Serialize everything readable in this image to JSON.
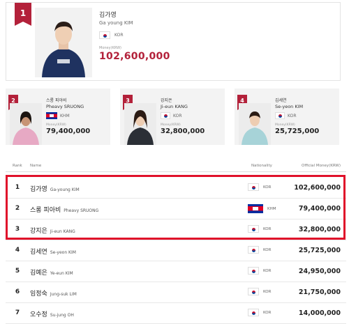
{
  "top": {
    "rank": "1",
    "name_ko": "김가영",
    "name_en": "Ga young KIM",
    "nationality": "KOR",
    "money_label": "Money(KRW)",
    "money": "102,600,000"
  },
  "cards": [
    {
      "rank": "2",
      "name_ko": "스롱 피아비",
      "name_en": "Pheavy SRUONG",
      "nationality": "KHM",
      "money_label": "Money(KRW)",
      "money": "79,400,000",
      "flag": "khm"
    },
    {
      "rank": "3",
      "name_ko": "강지은",
      "name_en": "Ji-eun KANG",
      "nationality": "KOR",
      "money_label": "Money(KRW)",
      "money": "32,800,000",
      "flag": "kor"
    },
    {
      "rank": "4",
      "name_ko": "김세연",
      "name_en": "Se-yeon KIM",
      "nationality": "KOR",
      "money_label": "Money(KRW)",
      "money": "25,725,000",
      "flag": "kor"
    }
  ],
  "table": {
    "headers": {
      "rank": "Rank",
      "name": "Name",
      "nationality": "Nationality",
      "money": "Official Money(KRW)"
    },
    "rows": [
      {
        "rank": "1",
        "name_ko": "김가영",
        "name_en": "Ga-young KIM",
        "nationality": "KOR",
        "money": "102,600,000",
        "flag": "kor"
      },
      {
        "rank": "2",
        "name_ko": "스롱 피아비",
        "name_en": "Pheavy SRUONG",
        "nationality": "KHM",
        "money": "79,400,000",
        "flag": "khm"
      },
      {
        "rank": "3",
        "name_ko": "강지은",
        "name_en": "Ji-eun KANG",
        "nationality": "KOR",
        "money": "32,800,000",
        "flag": "kor"
      },
      {
        "rank": "4",
        "name_ko": "김세연",
        "name_en": "Se-yeon KIM",
        "nationality": "KOR",
        "money": "25,725,000",
        "flag": "kor"
      },
      {
        "rank": "5",
        "name_ko": "김예은",
        "name_en": "Ye-eun KIM",
        "nationality": "KOR",
        "money": "24,950,000",
        "flag": "kor"
      },
      {
        "rank": "6",
        "name_ko": "임정숙",
        "name_en": "Jung-suk LIM",
        "nationality": "KOR",
        "money": "21,750,000",
        "flag": "kor"
      },
      {
        "rank": "7",
        "name_ko": "오수정",
        "name_en": "Su-jung OH",
        "nationality": "KOR",
        "money": "14,000,000",
        "flag": "kor"
      }
    ]
  },
  "colors": {
    "accent": "#b3213a",
    "highlight": "#e0102a"
  }
}
